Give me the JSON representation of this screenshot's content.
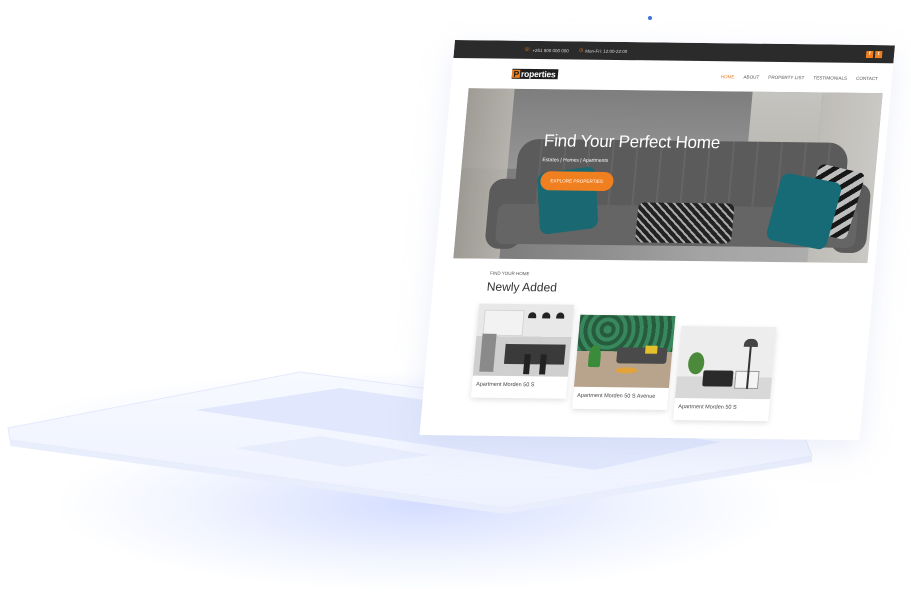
{
  "topbar": {
    "phone": "+251 900 000 000",
    "hours": "Mon-Fri: 12:00-22:00",
    "phone_icon": "phone-icon",
    "clock_icon": "clock-icon",
    "social": [
      "f",
      "t"
    ]
  },
  "nav": {
    "logo_mark": "P",
    "logo_rest": "roperties",
    "items": [
      "HOME",
      "ABOUT",
      "PROPERTY LIST",
      "TESTIMONIALS",
      "CONTACT"
    ]
  },
  "hero": {
    "title": "Find Your Perfect Home",
    "subtitle": "Estates | Homes | Apartments",
    "button": "EXPLORE PROPERTIES"
  },
  "section": {
    "kicker": "FIND YOUR HOME",
    "title": "Newly Added"
  },
  "cards": [
    {
      "caption": "Apartment Morden 50 S"
    },
    {
      "caption": "Apartment Morden 50 S Avenue"
    },
    {
      "caption": "Apartment Morden 50 S"
    }
  ],
  "colors": {
    "accent": "#f07f1f",
    "topbar_bg": "#2b2b2b",
    "base_tint": "#dde6ff"
  }
}
